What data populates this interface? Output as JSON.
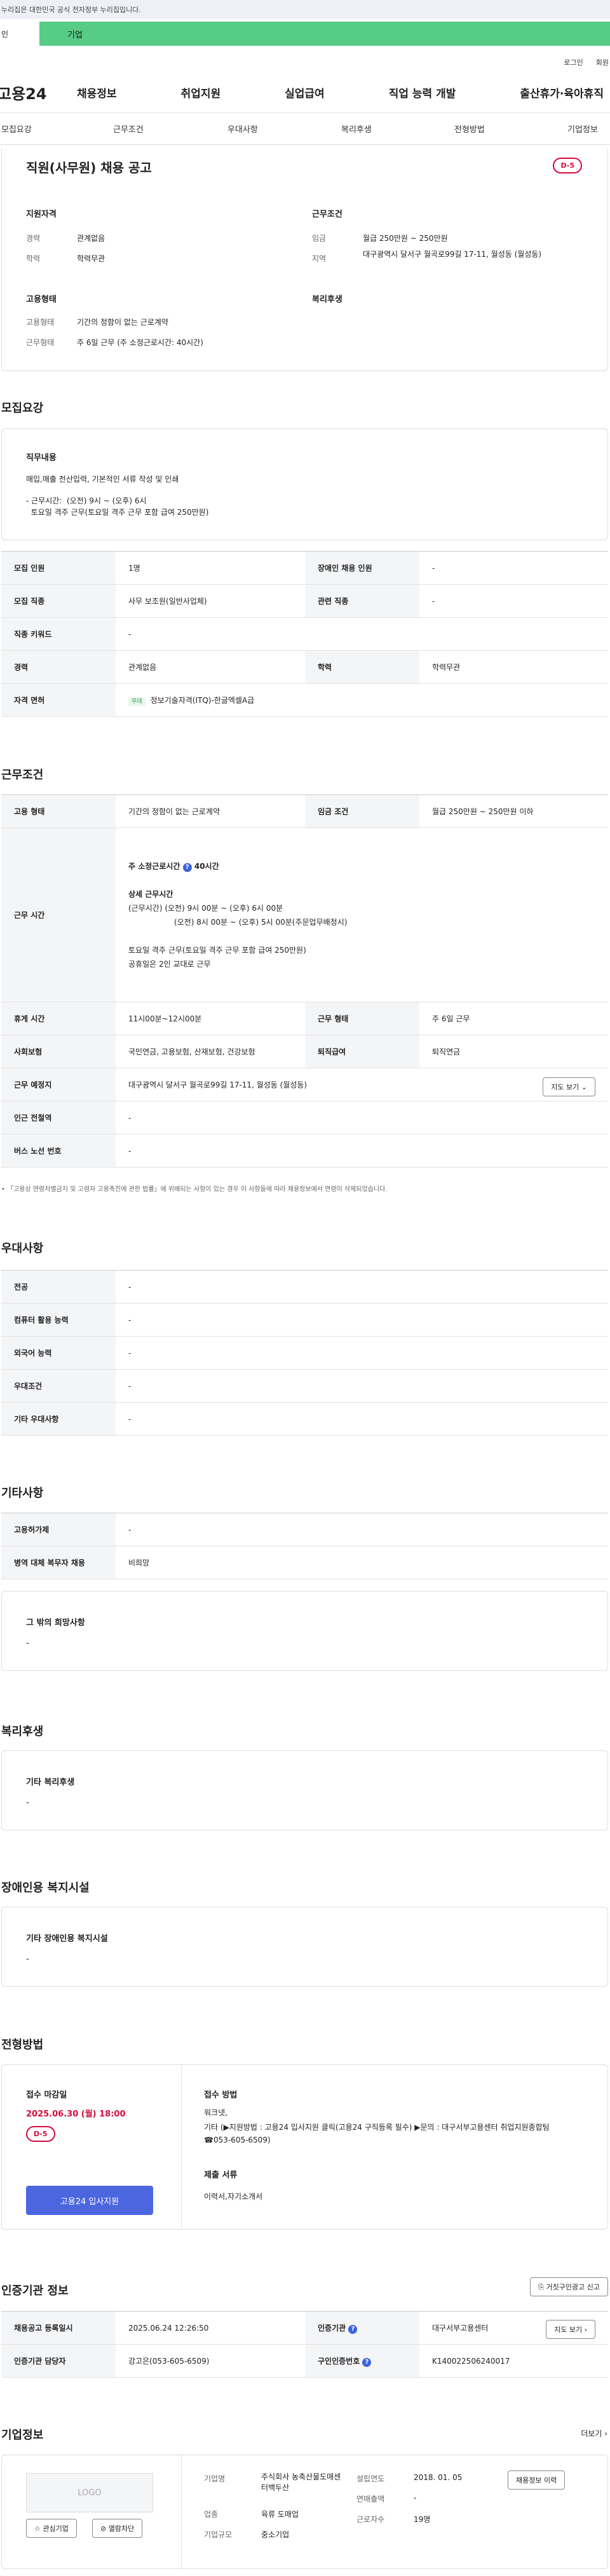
{
  "top_notice": "누리집은 대한민국 공식 전자정부 누리집입니다.",
  "tab_bar": {
    "left": "인",
    "active": "기업"
  },
  "auth": {
    "login": "로그인",
    "signup": "회원"
  },
  "logo": "고용24",
  "main_nav": [
    "채용정보",
    "취업지원",
    "실업급여",
    "직업 능력 개발",
    "출산휴가·육아휴직"
  ],
  "sub_nav": [
    "모집요강",
    "근무조건",
    "우대사항",
    "복리후생",
    "전형방법",
    "기업정보"
  ],
  "job": {
    "title": "직원(사무원) 채용 공고",
    "dday": "D-5",
    "qual_title": "지원자격",
    "cond_title": "근무조건",
    "career_label": "경력",
    "career": "관계없음",
    "edu_label": "학력",
    "edu": "학력무관",
    "wage_label": "임금",
    "wage": "월급 250만원 ~ 250만원",
    "region_label": "지역",
    "region": "대구광역시 달서구 월곡로99길 17-11, 월성동 (월성동)",
    "emp_title": "고용형태",
    "welfare_title": "복리후생",
    "emp_type_label": "고용형태",
    "emp_type": "기간의 정함이 없는 근로계약",
    "work_type_label": "근무형태",
    "work_type": "주 6일 근무 (주 소정근로시간: 40시간)"
  },
  "recruit": {
    "section_title": "모집요강",
    "duty_title": "직무내용",
    "duty_line1": "매입,매출 전산입력, 기본적인 서류 작성 및 인쇄",
    "duty_line2": "- 근무시간:  (오전) 9시 ~ (오후) 6시",
    "duty_line3": "  토요일 격주 근무(토요일 격주 근무 포함 급여 250만원)",
    "rows": [
      {
        "h1": "모집 인원",
        "v1": "1명",
        "h2": "장애인 채용 인원",
        "v2": "-"
      },
      {
        "h1": "모집 직종",
        "v1": "사무 보조원(일반사업체)",
        "h2": "관련 직종",
        "v2": "-"
      },
      {
        "h1": "직종 키워드",
        "v1": "-"
      },
      {
        "h1": "경력",
        "v1": "관계없음",
        "h2": "학력",
        "v2": "학력무관"
      },
      {
        "h1": "자격 면허",
        "v1": "정보기술자격(ITQ)-한글엑셀A급",
        "badge": "우대"
      }
    ]
  },
  "conditions": {
    "section_title": "근무조건",
    "emp_label": "고용 형태",
    "emp": "기간의 정함이 없는 근로계약",
    "wage_label": "임금 조건",
    "wage": "월급 250만원 ~ 250만원 이하",
    "time_label": "근무 시간",
    "weekly": "주 소정근로시간",
    "weekly_hours": "40시간",
    "detail_title": "상세 근무시간",
    "detail1": "(근무시간) (오전) 9시 00분 ~ (오후) 6시 00분",
    "detail2": "(오전) 8시 00분 ~ (오후) 5시 00분(주문업무배정시)",
    "detail3": "토요일 격주 근무(토요일 격주 근무 포함 급여 250만원)",
    "detail4": "공휴일은 2인 교대로 근무",
    "break_label": "휴게 시간",
    "break": "11시00분~12시00분",
    "form_label": "근무 형태",
    "form": "주 6일 근무",
    "insure_label": "사회보험",
    "insure": "국민연금, 고용보험, 산재보험, 건강보험",
    "pension_label": "퇴직급여",
    "pension": "퇴직연금",
    "place_label": "근무 예정지",
    "place": "대구광역시 달서구 월곡로99길 17-11, 월성동 (월성동)",
    "map_btn": "지도 보기",
    "subway_label": "인근 전철역",
    "subway": "-",
    "bus_label": "버스 노선 번호",
    "bus": "-",
    "note": "「고용상 연령차별금지 및 고령자 고용촉진에 관한 법률」에 위배되는 사항이 있는 경우 이 사항들에 따라 채용정보에서 연령이 삭제되었습니다."
  },
  "prefer": {
    "section_title": "우대사항",
    "rows": [
      {
        "h": "전공",
        "v": "-"
      },
      {
        "h": "컴퓨터 활용 능력",
        "v": "-"
      },
      {
        "h": "외국어 능력",
        "v": "-"
      },
      {
        "h": "우대조건",
        "v": "-"
      },
      {
        "h": "기타 우대사항",
        "v": "-"
      }
    ]
  },
  "etc": {
    "section_title": "기타사항",
    "rows": [
      {
        "h": "고용허가제",
        "v": "-"
      },
      {
        "h": "병역 대체 복무자 채용",
        "v": "비희망"
      }
    ],
    "other_title": "그 밖의 희망사항",
    "other": "-"
  },
  "welfare": {
    "section_title": "복리후생",
    "box_title": "기타 복리후생",
    "box_val": "-"
  },
  "disabled": {
    "section_title": "장애인용 복지시설",
    "box_title": "기타 장애인용 복지시설",
    "box_val": "-"
  },
  "process": {
    "section_title": "전형방법",
    "deadline_label": "접수 마감일",
    "deadline": "2025.06.30 (월) 18:00",
    "dday": "D-5",
    "apply_btn": "고용24 입사지원",
    "method_label": "접수 방법",
    "method1": "워크넷,",
    "method2": "기타 (▶지원방법 : 고용24 입사지원 클릭(고용24 구직등록 필수) ▶문의 : 대구서부고용센터 취업지원종합팀 ☎053-605-6509)",
    "docs_label": "제출 서류",
    "docs": "이력서,자기소개서"
  },
  "agency": {
    "section_title": "인증기관 정보",
    "report_btn": "거짓구인광고 신고",
    "reg_label": "채용공고 등록일시",
    "reg": "2025.06.24 12:26:50",
    "org_label": "인증기관",
    "org": "대구서부고용센터",
    "map_btn": "지도 보기",
    "mgr_label": "인증기관 담당자",
    "mgr": "강고은(053-605-6509)",
    "num_label": "구인인증번호",
    "num": "K140022506240017"
  },
  "company": {
    "section_title": "기업정보",
    "more": "더보기",
    "logo_text": "LOGO",
    "interest_btn": "관심기업",
    "block_btn": "열람차단",
    "name_label": "기업명",
    "name": "주식회사 농축산물도매센터백두산",
    "industry_label": "업종",
    "industry": "육류 도매업",
    "size_label": "기업규모",
    "size": "중소기업",
    "founded_label": "설립연도",
    "founded": "2018. 01. 05",
    "sales_label": "연매출액",
    "sales": "-",
    "staff_label": "근로자수",
    "staff": "19명",
    "jobs_btn": "채용정보 이력"
  }
}
